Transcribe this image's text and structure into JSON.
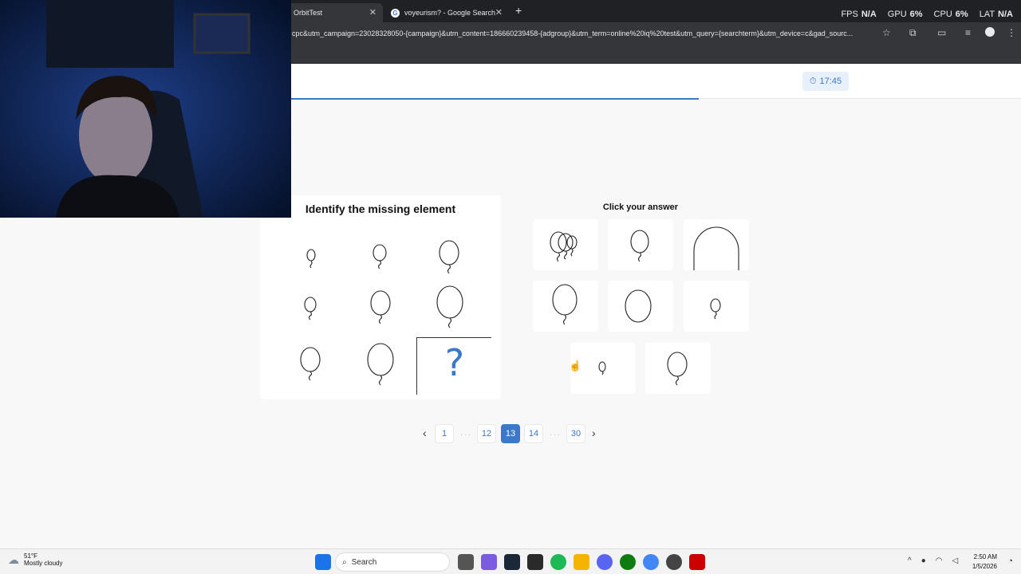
{
  "browser": {
    "tabs": [
      {
        "label": "OrbitTest",
        "active": true
      },
      {
        "label": "voyeurism? - Google Search",
        "active": false
      }
    ],
    "new_tab_label": "+",
    "url": "cpc&utm_campaign=23028328050-{campaign}&utm_content=186660239458-{adgroup}&utm_term=online%20iq%20test&utm_query={searchterm}&utm_device=c&gad_sourc...",
    "perf": {
      "fps_label": "FPS",
      "fps_value": "N/A",
      "gpu_label": "GPU",
      "gpu_value": "6%",
      "cpu_label": "CPU",
      "cpu_value": "6%",
      "lat_label": "LAT",
      "lat_value": "N/A"
    }
  },
  "test": {
    "timer": "17:45",
    "progress": 0.684,
    "question_title": "Identify the missing element",
    "missing_symbol": "?",
    "answers_title": "Click your answer",
    "pagination": {
      "prev": "‹",
      "first": "1",
      "ellipsis": "...",
      "before": "12",
      "current": "13",
      "after": "14",
      "last": "30",
      "next": "›"
    }
  },
  "taskbar": {
    "weather_temp": "51°F",
    "weather_desc": "Mostly cloudy",
    "search_label": "Search",
    "time": "2:50 AM",
    "date": "1/5/2026"
  },
  "colors": {
    "accent": "#3b78c9",
    "browser_dark": "#202124",
    "browser_toolbar": "#35363a"
  }
}
